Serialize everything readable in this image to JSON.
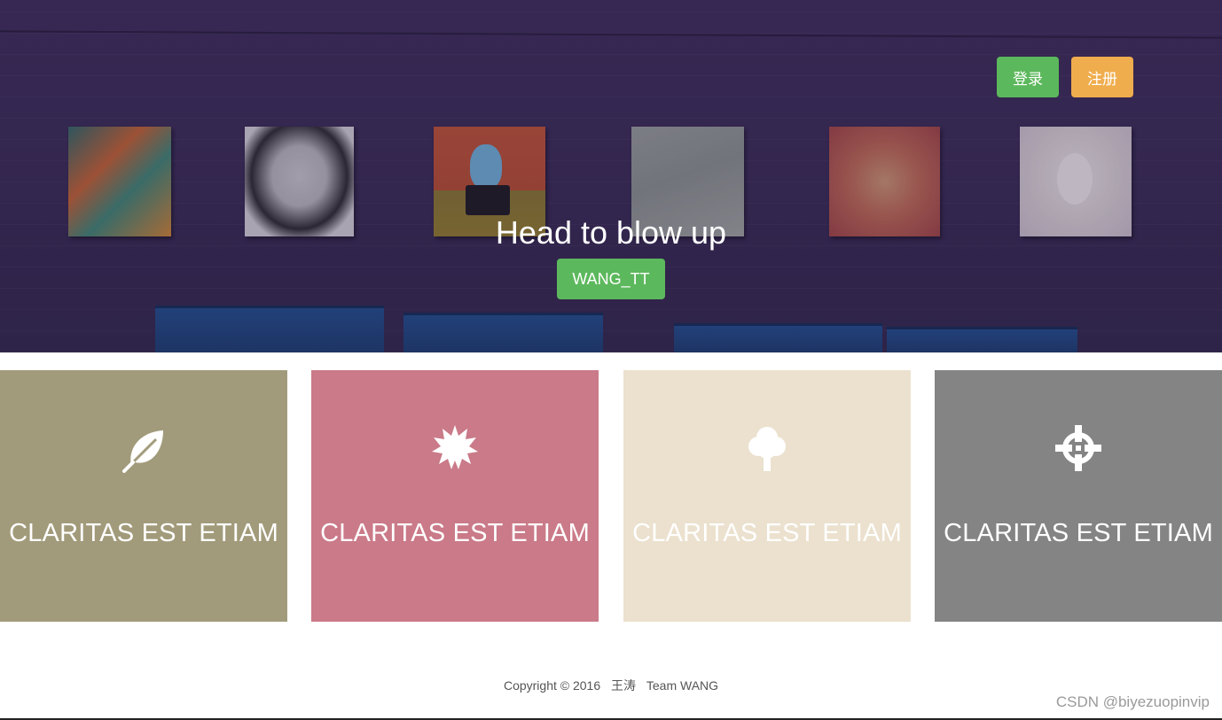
{
  "header": {
    "login_label": "登录",
    "register_label": "注册"
  },
  "hero": {
    "title": "Head to blow up",
    "button_label": "WANG_TT"
  },
  "features": [
    {
      "icon": "leaf-icon",
      "label": "CLARITAS EST ETIAM",
      "color": "#a29b7b"
    },
    {
      "icon": "starburst-icon",
      "label": "CLARITAS EST ETIAM",
      "color": "#ca7a88"
    },
    {
      "icon": "tree-icon",
      "label": "CLARITAS EST ETIAM",
      "color": "#ebe1ce"
    },
    {
      "icon": "crosshair-icon",
      "label": "CLARITAS EST ETIAM",
      "color": "#848484"
    }
  ],
  "footer": {
    "copyright": "Copyright © 2016",
    "author": "王涛",
    "team": "Team WANG"
  },
  "watermark": "CSDN @biyezuopinvip",
  "colors": {
    "success": "#5cb85c",
    "warning": "#f0ad4e"
  }
}
